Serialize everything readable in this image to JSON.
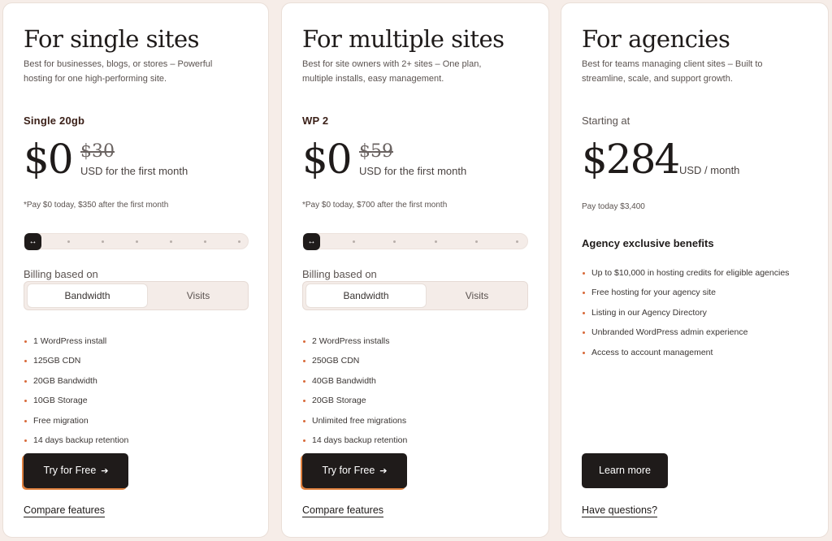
{
  "cards": [
    {
      "title": "For single sites",
      "description": "Best for businesses, blogs, or stores – Powerful hosting for one high-performing site.",
      "plan_name": "Single 20gb",
      "price": "$0",
      "old_price": "$30",
      "price_period": "USD for the first month",
      "note": "*Pay $0 today, $350 after the first month",
      "slider_icon": "resize-horizontal-icon",
      "slider_level": 0,
      "billing_label": "Billing based on",
      "billing_options": [
        "Bandwidth",
        "Visits"
      ],
      "billing_selected": "Bandwidth",
      "features": [
        "1 WordPress install",
        "125GB CDN",
        "20GB Bandwidth",
        "10GB Storage",
        "Free migration",
        "14 days backup retention"
      ],
      "cta_label": "Try for Free",
      "link_label": "Compare features"
    },
    {
      "title": "For multiple sites",
      "description": "Best for site owners with 2+ sites – One plan, multiple installs, easy management.",
      "plan_name": "WP 2",
      "price": "$0",
      "old_price": "$59",
      "price_period": "USD for the first month",
      "note": "*Pay $0 today, $700 after the first month",
      "slider_icon": "resize-horizontal-icon",
      "slider_level": 0,
      "billing_label": "Billing based on",
      "billing_options": [
        "Bandwidth",
        "Visits"
      ],
      "billing_selected": "Bandwidth",
      "features": [
        "2 WordPress installs",
        "250GB CDN",
        "40GB Bandwidth",
        "20GB Storage",
        "Unlimited free migrations",
        "14 days backup retention"
      ],
      "cta_label": "Try for Free",
      "link_label": "Compare features"
    },
    {
      "title": "For agencies",
      "description": "Best for teams managing client sites – Built to streamline, scale, and support growth.",
      "starting_label": "Starting at",
      "price": "$284",
      "price_period": "USD / month",
      "note": "Pay today $3,400",
      "benefits_heading": "Agency exclusive benefits",
      "features": [
        "Up to $10,000 in hosting credits for eligible agencies",
        "Free hosting for your agency site",
        "Listing in our Agency Directory",
        "Unbranded WordPress admin experience",
        "Access to account management"
      ],
      "cta_label": "Learn more",
      "link_label": "Have questions?"
    }
  ],
  "colors": {
    "page_bg": "#f6ede8",
    "card_bg": "#ffffff",
    "dark": "#1f1b1a",
    "accent": "#e0813f",
    "bullet": "#d86a3a"
  }
}
